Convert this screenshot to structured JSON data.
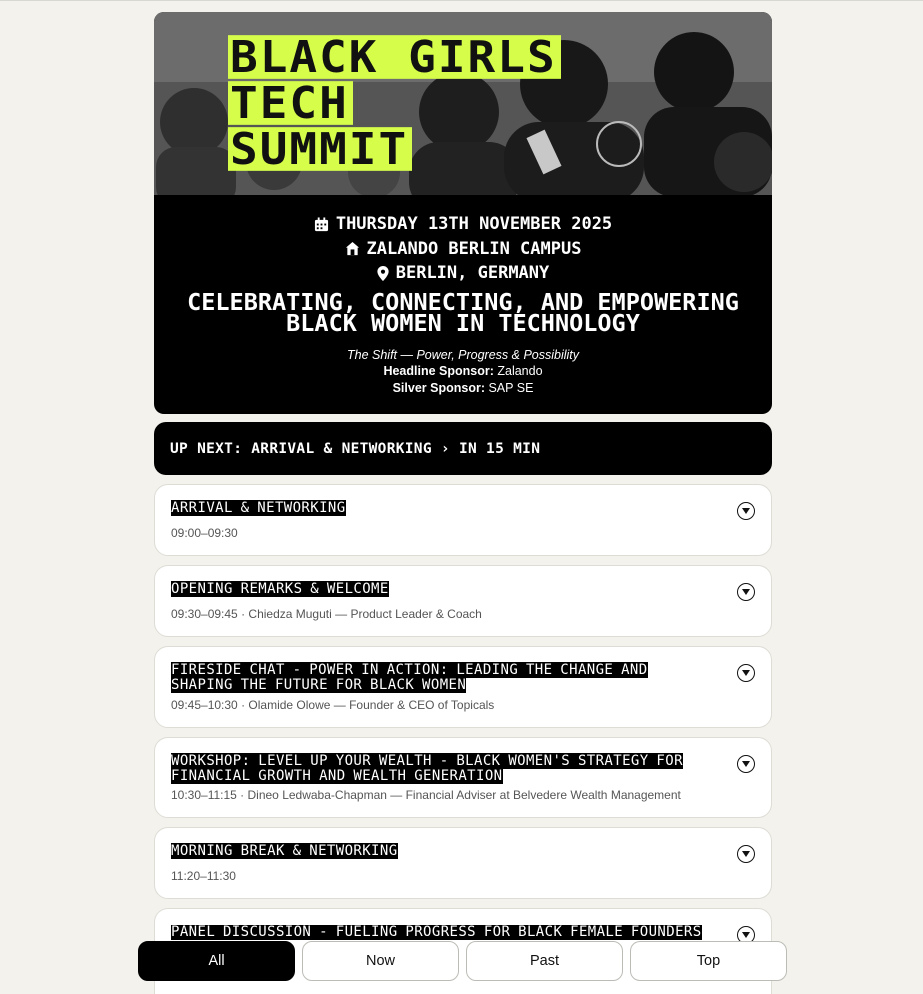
{
  "hero": {
    "logo_lines": [
      "BLACK GIRLS",
      "TECH",
      "SUMMIT"
    ],
    "date": "Thursday 13th November 2025",
    "venue": "Zalando Berlin Campus",
    "location": "Berlin, Germany",
    "tagline": "Celebrating, connecting, and empowering Black women in technology",
    "theme": "The Shift — Power, Progress & Possibility",
    "headline_sponsor_label": "Headline Sponsor:",
    "headline_sponsor": "Zalando",
    "silver_sponsor_label": "Silver Sponsor:",
    "silver_sponsor": "SAP SE",
    "icons": [
      "calendar-icon",
      "building-icon",
      "map-pin-icon"
    ]
  },
  "up_next": "Up next: Arrival & Networking › in 15 min",
  "sessions": [
    {
      "title": "Arrival & Networking",
      "meta": "09:00–09:30"
    },
    {
      "title": "Opening Remarks & Welcome",
      "meta": "09:30–09:45 · Chiedza Muguti — Product Leader & Coach"
    },
    {
      "title": "Fireside Chat - Power in Action: Leading the Change and Shaping the Future for Black Women",
      "meta": "09:45–10:30 · Olamide Olowe — Founder & CEO of Topicals"
    },
    {
      "title": "Workshop: Level Up Your Wealth - Black Women's Strategy for Financial Growth and Wealth Generation",
      "meta": "10:30–11:15 · Dineo Ledwaba-Chapman — Financial Adviser at Belvedere Wealth Management"
    },
    {
      "title": "Morning Break & Networking",
      "meta": "11:20–11:30"
    },
    {
      "title": "Panel Discussion - Fueling Progress for Black Female Founders",
      "meta": ""
    }
  ],
  "nav": {
    "all": "All",
    "now": "Now",
    "past": "Past",
    "top": "Top",
    "active": "All"
  },
  "colors": {
    "accent": "#d6fd4a",
    "background": "#f3f2ec",
    "card": "#ffffff",
    "dark": "#000000"
  }
}
